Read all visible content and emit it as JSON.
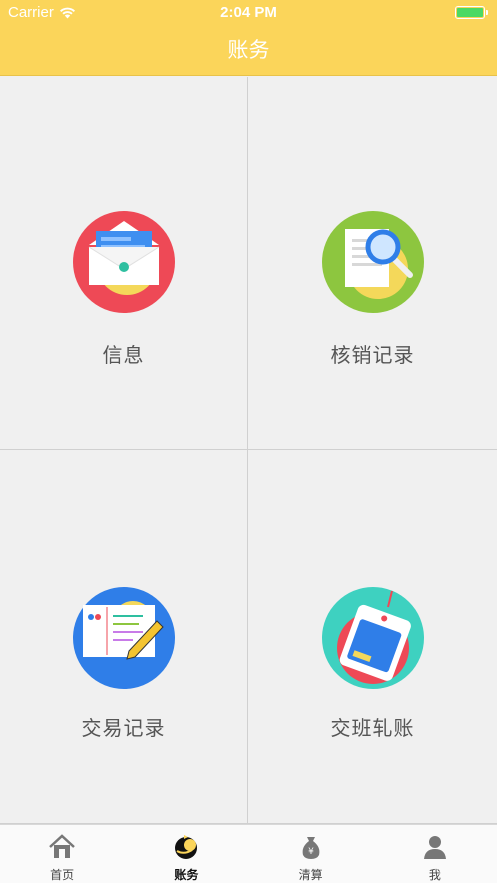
{
  "status_bar": {
    "carrier": "Carrier",
    "time": "2:04 PM"
  },
  "nav": {
    "title": "账务"
  },
  "menu": [
    {
      "label": "信息",
      "icon": "envelope-icon"
    },
    {
      "label": "核销记录",
      "icon": "document-search-icon"
    },
    {
      "label": "交易记录",
      "icon": "notebook-pencil-icon"
    },
    {
      "label": "交班轧账",
      "icon": "price-tag-card-icon"
    }
  ],
  "tabs": [
    {
      "label": "首页",
      "icon": "home-icon"
    },
    {
      "label": "账务",
      "icon": "accounts-icon",
      "active": true
    },
    {
      "label": "清算",
      "icon": "money-bag-icon"
    },
    {
      "label": "我",
      "icon": "profile-icon"
    }
  ],
  "colors": {
    "header": "#fbd55a",
    "background": "#f0f0f0"
  }
}
